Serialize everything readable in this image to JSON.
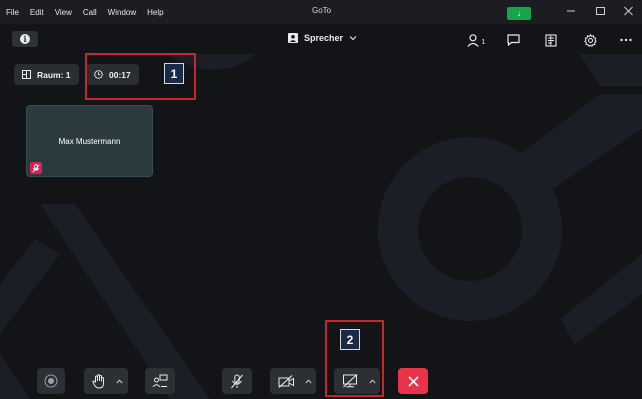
{
  "titlebar": {
    "menu": [
      "File",
      "Edit",
      "View",
      "Call",
      "Window",
      "Help"
    ],
    "app_title": "GoTo",
    "update_badge": "↓"
  },
  "toolbar": {
    "view_mode_label": "Sprecher",
    "participant_count": "1"
  },
  "session": {
    "room_label": "Raum: 1",
    "timer": "00:17"
  },
  "participants": [
    {
      "name": "Max Mustermann",
      "muted": true
    }
  ],
  "annotations": [
    {
      "number": "1"
    },
    {
      "number": "2"
    }
  ],
  "colors": {
    "background": "#121418",
    "tile": "#2a3a3e",
    "leave_button": "#e8344a",
    "muted_badge": "#d81e5b",
    "annotation_border": "#c8262a",
    "update_badge": "#17a54a"
  },
  "icons": {
    "info": "info-icon",
    "view_mode": "speaker-view-icon",
    "participants": "person-icon",
    "chat": "chat-icon",
    "notes": "notes-icon",
    "settings": "gear-icon",
    "more": "more-icon",
    "record": "record-icon",
    "hand": "raise-hand-icon",
    "share": "screen-share-icon",
    "mic": "mic-off-icon",
    "camera": "camera-off-icon",
    "screen_camera": "screen-camera-off-icon",
    "leave": "close-icon"
  }
}
